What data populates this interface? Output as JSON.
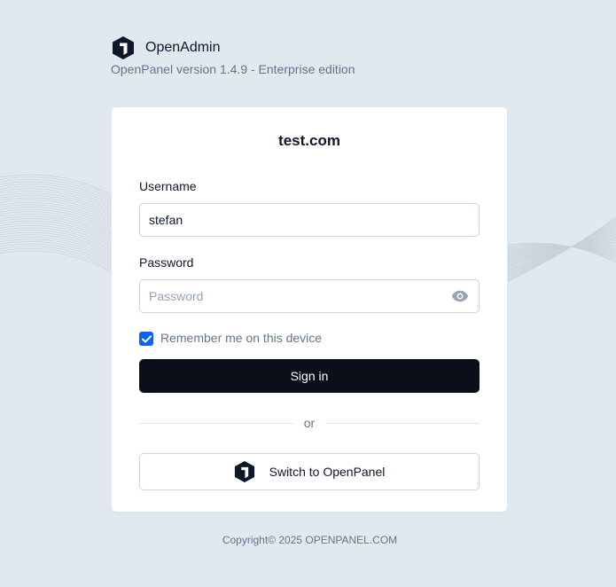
{
  "brand": {
    "name": "OpenAdmin",
    "icon": "openpanel-logo-icon"
  },
  "version_text": "OpenPanel version 1.4.9 - Enterprise edition",
  "form": {
    "domain": "test.com",
    "username_label": "Username",
    "username_value": "stefan",
    "password_label": "Password",
    "password_placeholder": "Password",
    "password_value": "",
    "remember_label": "Remember me on this device",
    "remember_checked": true,
    "signin_label": "Sign in",
    "divider_text": "or",
    "switch_label": "Switch to OpenPanel"
  },
  "footer": {
    "copyright": "Copyright© 2025 OPENPANEL.COM"
  },
  "colors": {
    "background": "#e2e8f0",
    "card": "#ffffff",
    "primary_button": "#0b0f19",
    "checkbox": "#0b63f5",
    "muted_text": "#64748b"
  }
}
